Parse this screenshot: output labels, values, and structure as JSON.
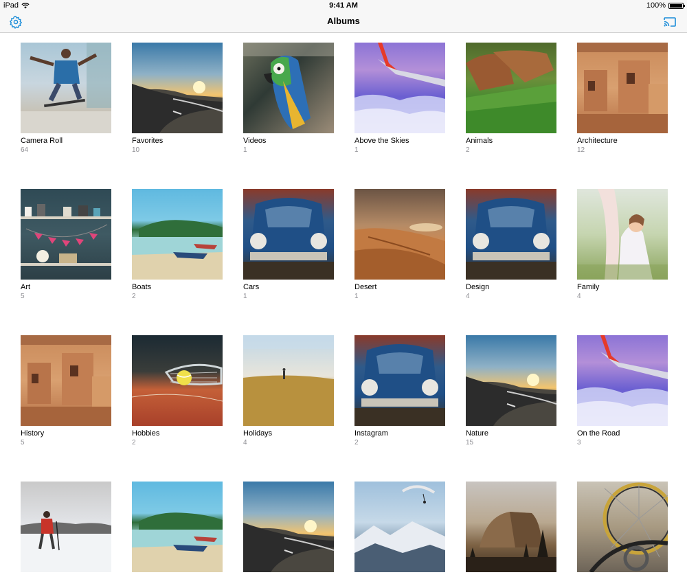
{
  "status": {
    "device": "iPad",
    "time": "9:41 AM",
    "battery": "100%",
    "battery_level": 1.0
  },
  "nav": {
    "title": "Albums"
  },
  "accent": "#1a8cd8",
  "albums": [
    {
      "title": "Camera Roll",
      "count": "64",
      "bg": "linear-gradient(180deg,#a9c6d6 0%,#c8d6df 45%,#c7c3b8 75%,#e4e3de 100%)",
      "art": "skate"
    },
    {
      "title": "Favorites",
      "count": "10",
      "bg": "linear-gradient(180deg,#3a79a8 0%,#8fb1c6 35%,#f3c46e 58%,#5f5b4e 70%,#3c3c3c 100%)",
      "art": "road"
    },
    {
      "title": "Videos",
      "count": "1",
      "bg": "linear-gradient(135deg,#6a6d5b 0%,#2f3a35 40%,#9b8c78 100%)",
      "art": "parrot"
    },
    {
      "title": "Above the Skies",
      "count": "1",
      "bg": "linear-gradient(180deg,#8c74d6 0%,#b38fd8 30%,#6a5fd1 60%,#a592e8 100%)",
      "art": "wing"
    },
    {
      "title": "Animals",
      "count": "2",
      "bg": "linear-gradient(180deg,#4f6a2c 0%,#6c8f3a 40%,#3a8a2e 70%,#2a6a22 100%)",
      "art": "dogs"
    },
    {
      "title": "Architecture",
      "count": "12",
      "bg": "linear-gradient(180deg,#c98a5a 0%,#d9a070 50%,#b56f44 100%)",
      "art": "ruins"
    },
    {
      "title": "Art",
      "count": "5",
      "bg": "linear-gradient(180deg,#2f4a55 0%,#3f5a63 50%,#2c3f46 100%)",
      "art": "shelf"
    },
    {
      "title": "Boats",
      "count": "2",
      "bg": "linear-gradient(180deg,#5fb9e0 0%,#7ecae6 35%,#2f6e3a 45%,#9fd5d7 60%,#d9c9a4 100%)",
      "art": "beach"
    },
    {
      "title": "Cars",
      "count": "1",
      "bg": "linear-gradient(180deg,#8a3a2a 0%,#2f5a8a 35%,#1f4f86 65%,#3a3024 100%)",
      "art": "car"
    },
    {
      "title": "Desert",
      "count": "1",
      "bg": "linear-gradient(180deg,#6b5444 0%,#b58b66 40%,#d58a4d 65%,#a9602c 100%)",
      "art": "dune"
    },
    {
      "title": "Design",
      "count": "4",
      "bg": "linear-gradient(180deg,#8a3a2a 0%,#2f5a8a 35%,#1f4f86 65%,#3a3024 100%)",
      "art": "car"
    },
    {
      "title": "Family",
      "count": "4",
      "bg": "linear-gradient(180deg,#dfe6dc 0%,#c6d5b0 50%,#8aa45c 100%)",
      "art": "girl"
    },
    {
      "title": "History",
      "count": "5",
      "bg": "linear-gradient(180deg,#c98a5a 0%,#d9a070 50%,#b56f44 100%)",
      "art": "ruins"
    },
    {
      "title": "Hobbies",
      "count": "2",
      "bg": "linear-gradient(180deg,#1b2a33 0%,#3a3d3a 40%,#c46038 60%,#a8402a 100%)",
      "art": "tennis"
    },
    {
      "title": "Holidays",
      "count": "4",
      "bg": "linear-gradient(180deg,#bfd6e6 0%,#e8e5db 45%,#c7a25a 60%,#9e7a36 100%)",
      "art": "field"
    },
    {
      "title": "Instagram",
      "count": "2",
      "bg": "linear-gradient(180deg,#8a3a2a 0%,#2f5a8a 35%,#1f4f86 65%,#3a3024 100%)",
      "art": "car"
    },
    {
      "title": "Nature",
      "count": "15",
      "bg": "linear-gradient(180deg,#3a79a8 0%,#8fb1c6 35%,#f3c46e 58%,#5f5b4e 70%,#3c3c3c 100%)",
      "art": "road"
    },
    {
      "title": "On the Road",
      "count": "3",
      "bg": "linear-gradient(180deg,#8c74d6 0%,#b38fd8 30%,#6a5fd1 60%,#a592e8 100%)",
      "art": "wing"
    },
    {
      "title": "",
      "count": "",
      "bg": "linear-gradient(180deg,#c9c9c9 0%,#e4e6ea 50%,#f4f5f7 100%)",
      "art": "hiker"
    },
    {
      "title": "",
      "count": "",
      "bg": "linear-gradient(180deg,#5fb9e0 0%,#7ecae6 35%,#2f6e3a 45%,#9fd5d7 60%,#d9c9a4 100%)",
      "art": "beach"
    },
    {
      "title": "",
      "count": "",
      "bg": "linear-gradient(180deg,#3a79a8 0%,#8fb1c6 35%,#f3c46e 58%,#5f5b4e 70%,#3c3c3c 100%)",
      "art": "road"
    },
    {
      "title": "",
      "count": "",
      "bg": "linear-gradient(180deg,#9fc0dc 0%,#c6d9e8 45%,#8aa2b8 65%,#3a4a5a 100%)",
      "art": "mountain"
    },
    {
      "title": "",
      "count": "",
      "bg": "linear-gradient(180deg,#c8c4c0 0%,#b9a890 45%,#7d6244 70%,#3a2d20 100%)",
      "art": "halfdome"
    },
    {
      "title": "",
      "count": "",
      "bg": "linear-gradient(180deg,#c9c3b6 0%,#a89a82 50%,#6d6458 100%)",
      "art": "bike"
    }
  ]
}
